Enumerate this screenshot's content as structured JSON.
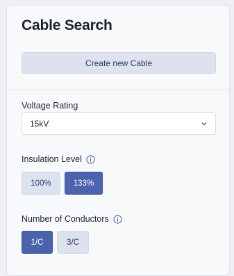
{
  "panel": {
    "title": "Cable Search",
    "create_button_label": "Create new Cable"
  },
  "voltage": {
    "label": "Voltage Rating",
    "selected": "15kV"
  },
  "insulation": {
    "label": "Insulation Level",
    "options": [
      "100%",
      "133%"
    ],
    "selected": "133%"
  },
  "conductors": {
    "label": "Number of Conductors",
    "options": [
      "1/C",
      "3/C"
    ],
    "selected": "1/C"
  },
  "colors": {
    "accent": "#4b63ae",
    "chip_inactive": "#dde2ef"
  }
}
